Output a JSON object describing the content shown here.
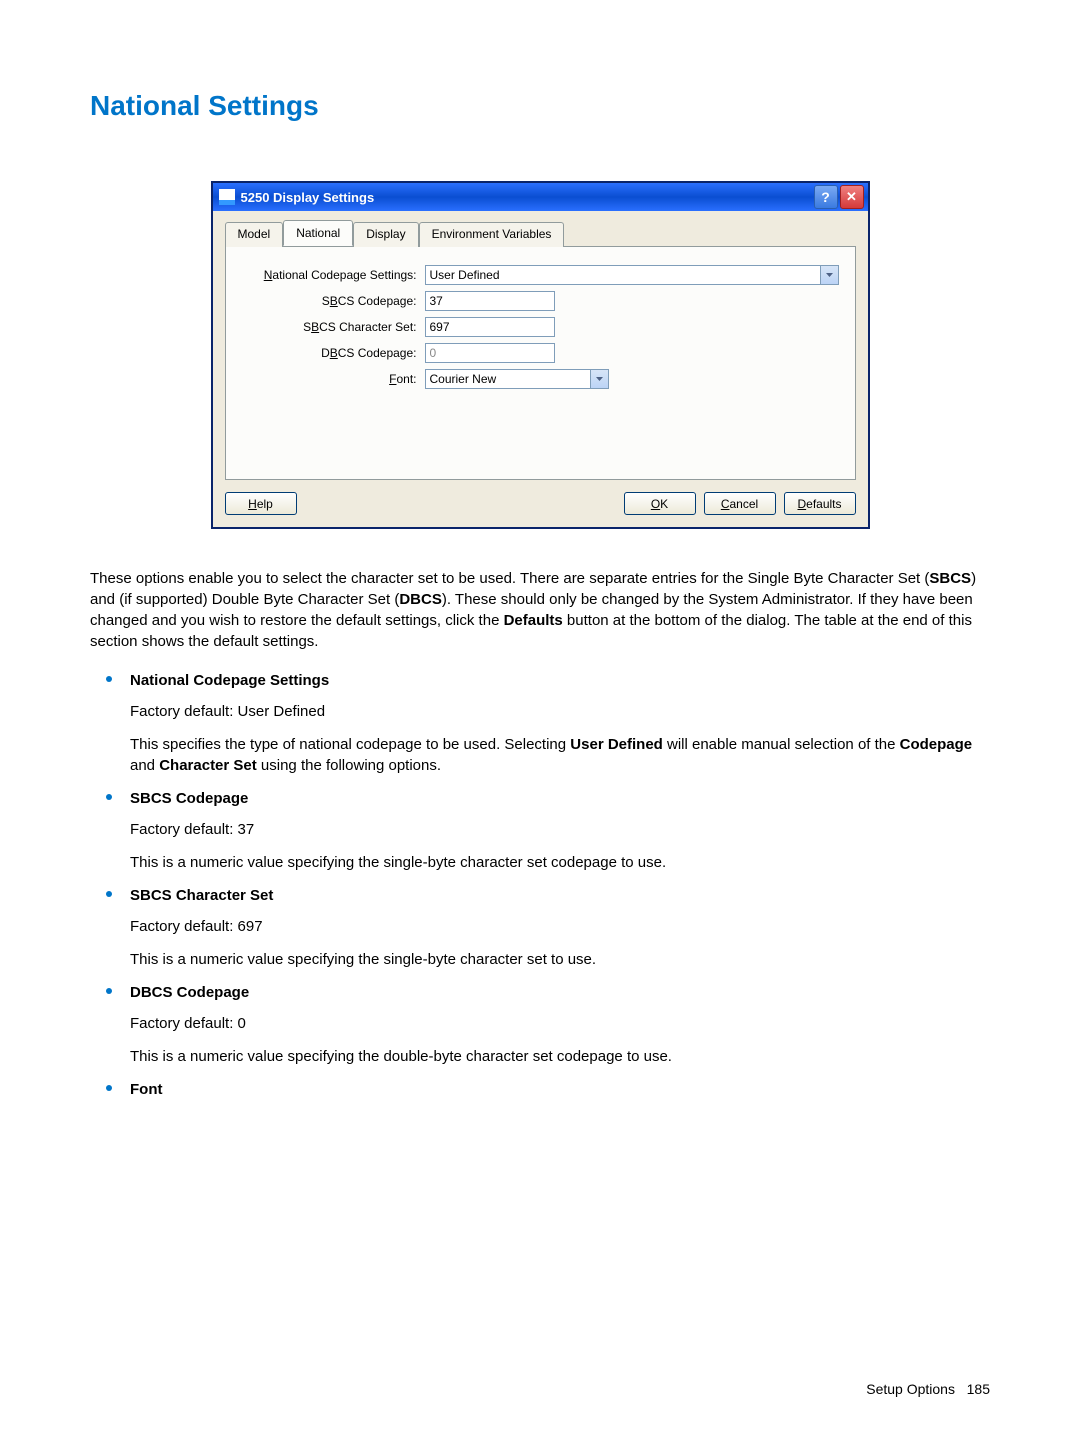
{
  "heading": "National Settings",
  "dialog": {
    "title": "5250 Display Settings",
    "tabs": [
      "Model",
      "National",
      "Display",
      "Environment Variables"
    ],
    "active_tab": 1,
    "fields": {
      "ncs_label": "National Codepage Settings:",
      "ncs_value": "User Defined",
      "sbcs_cp_label": "SBCS Codepage:",
      "sbcs_cp_value": "37",
      "sbcs_cs_label": "SBCS Character Set:",
      "sbcs_cs_value": "697",
      "dbcs_cp_label": "DBCS Codepage:",
      "dbcs_cp_value": "0",
      "font_label": "Font:",
      "font_value": "Courier New"
    },
    "buttons": {
      "help": "Help",
      "ok": "OK",
      "cancel": "Cancel",
      "defaults": "Defaults"
    }
  },
  "intro": {
    "t1": "These options enable you to select the character set to be used. There are separate entries for the Single Byte Character Set (",
    "t2": "SBCS",
    "t3": ") and (if supported) Double Byte Character Set (",
    "t4": "DBCS",
    "t5": "). These should only be changed by the System Administrator. If they have been changed and you wish to restore the default settings, click the ",
    "t6": "Defaults",
    "t7": " button at the bottom of the dialog. The table at the end of this section shows the default settings."
  },
  "items": [
    {
      "title": "National Codepage Settings",
      "p1": "Factory default: User Defined",
      "p2a": "This specifies the type of national codepage to be used. Selecting ",
      "p2b": "User Defined",
      "p2c": " will enable manual selection of the ",
      "p2d": "Codepage",
      "p2e": " and ",
      "p2f": "Character Set",
      "p2g": " using the following options."
    },
    {
      "title": "SBCS Codepage",
      "p1": "Factory default: 37",
      "p2": "This is a numeric value specifying the single-byte character set codepage to use."
    },
    {
      "title": "SBCS Character Set",
      "p1": "Factory default: 697",
      "p2": "This is a numeric value specifying the single-byte character set to use."
    },
    {
      "title": "DBCS Codepage",
      "p1": "Factory default: 0",
      "p2": "This is a numeric value specifying the double-byte character set codepage to use."
    },
    {
      "title": "Font"
    }
  ],
  "footer": {
    "label": "Setup Options",
    "page": "185"
  }
}
